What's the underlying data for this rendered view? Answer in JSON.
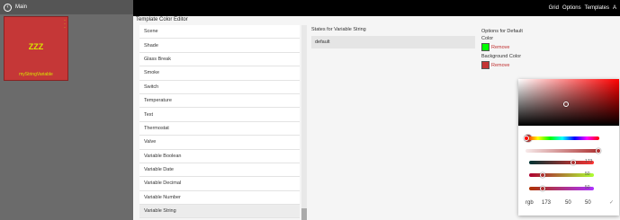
{
  "sidebar": {
    "home_label": "Main",
    "tile": {
      "text": "ZZZ",
      "subtitle": "myStringVariable"
    }
  },
  "topbar": {
    "items": [
      "Grid",
      "Options",
      "Templates",
      "A"
    ]
  },
  "editor": {
    "title": "Template Color Editor",
    "variable_types": [
      "Scene",
      "Shade",
      "Glass Break",
      "Smoke",
      "Switch",
      "Temperature",
      "Text",
      "Thermostat",
      "Valve",
      "Variable Boolean",
      "Variable Date",
      "Variable Decimal",
      "Variable Number",
      "Variable String"
    ],
    "selected_type": "Variable String",
    "states_title": "States for Variable String",
    "states": [
      "default"
    ],
    "options": {
      "title": "Options for Default",
      "color_label": "Color",
      "color_value": "#00ff00",
      "remove_label": "Remove",
      "bg_label": "Background Color",
      "bg_value": "#c43333",
      "bg_remove_label": "Remove"
    }
  },
  "color_picker": {
    "rgb_label": "rgb",
    "r": "173",
    "g": "50",
    "b": "50",
    "check_glyph": "✓",
    "slider_values": [
      "173",
      "50",
      "50"
    ]
  },
  "colors": {
    "tile_red": "#c53737",
    "tile_text": "#d7e600",
    "remove_red": "#c03030"
  }
}
